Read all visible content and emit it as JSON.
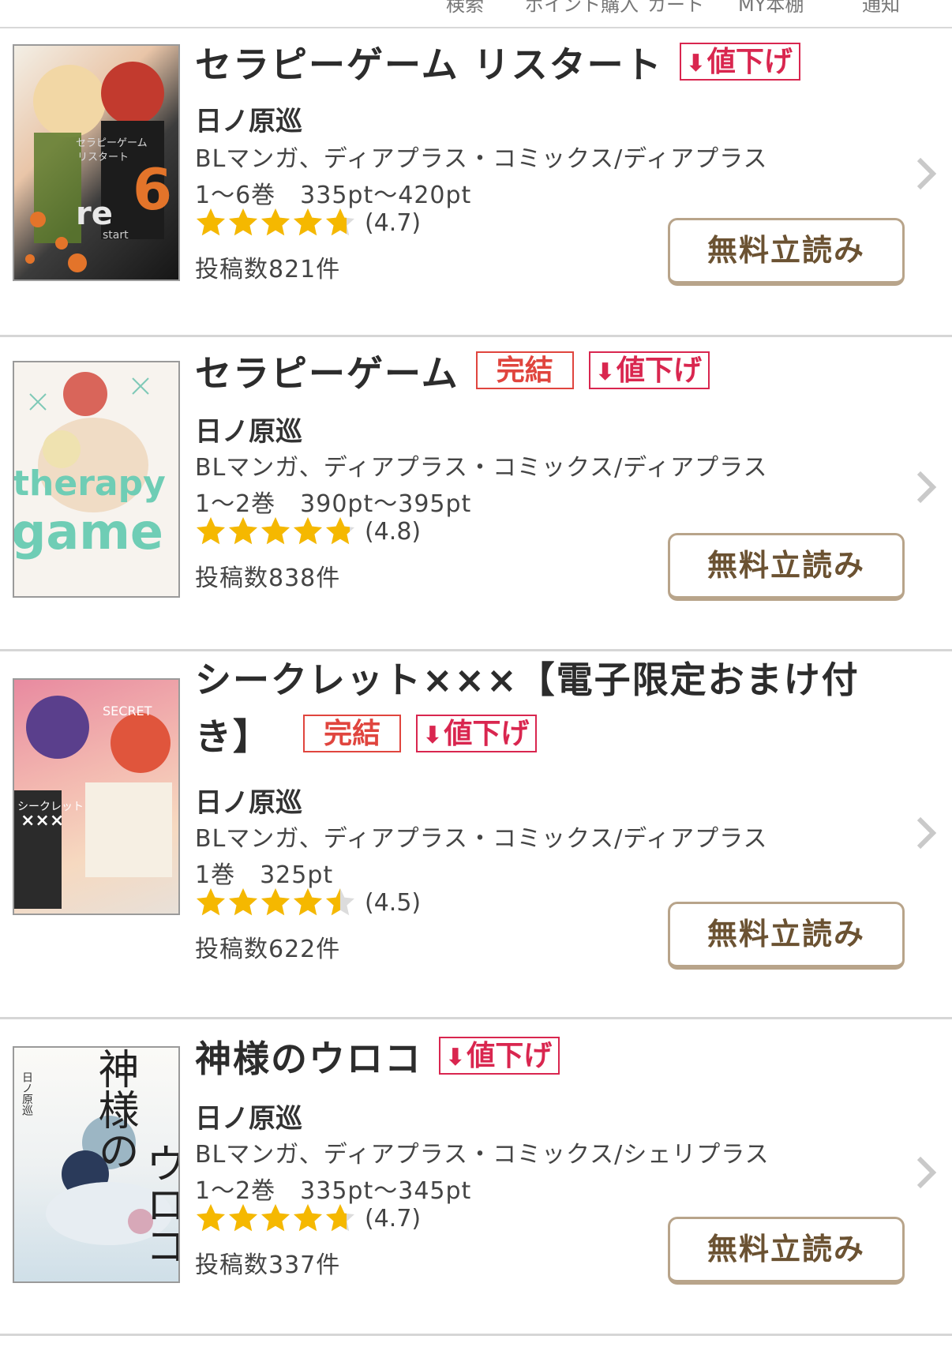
{
  "top_nav": {
    "items": [
      "検索",
      "ポイント購入",
      "カート",
      "MY本棚",
      "通知"
    ]
  },
  "items": [
    {
      "title": "セラピーゲーム リスタート",
      "badges": [
        {
          "type": "down",
          "label": "値下げ",
          "icon": "down-arrow-icon"
        }
      ],
      "author": "日ノ原巡",
      "genre": "BLマンガ、ディアプラス・コミックス/ディアプラス",
      "volumes": "1〜6巻　335pt〜420pt",
      "rating": 4.7,
      "rating_label": "(4.7)",
      "posts": "投稿数821件",
      "button_label": "無料立読み",
      "cover_texts": [
        "セラピーゲーム",
        "リスタート",
        "re",
        "start",
        "6"
      ]
    },
    {
      "title": "セラピーゲーム",
      "badges": [
        {
          "type": "complete",
          "label": "完結"
        },
        {
          "type": "down",
          "label": "値下げ",
          "icon": "down-arrow-icon"
        }
      ],
      "author": "日ノ原巡",
      "genre": "BLマンガ、ディアプラス・コミックス/ディアプラス",
      "volumes": "1〜2巻　390pt〜395pt",
      "rating": 4.8,
      "rating_label": "(4.8)",
      "posts": "投稿数838件",
      "button_label": "無料立読み",
      "cover_texts": [
        "therapy",
        "game"
      ]
    },
    {
      "title": "シークレット×××【電子限定おまけ付き】",
      "badges": [
        {
          "type": "complete",
          "label": "完結"
        },
        {
          "type": "down",
          "label": "値下げ",
          "icon": "down-arrow-icon"
        }
      ],
      "author": "日ノ原巡",
      "genre": "BLマンガ、ディアプラス・コミックス/ディアプラス",
      "volumes": "1巻　325pt",
      "rating": 4.5,
      "rating_label": "(4.5)",
      "posts": "投稿数622件",
      "button_label": "無料立読み",
      "cover_texts": [
        "SECRET",
        "シークレット",
        "×××"
      ]
    },
    {
      "title": "神様のウロコ",
      "badges": [
        {
          "type": "down",
          "label": "値下げ",
          "icon": "down-arrow-icon"
        }
      ],
      "author": "日ノ原巡",
      "genre": "BLマンガ、ディアプラス・コミックス/シェリプラス",
      "volumes": "1〜2巻　335pt〜345pt",
      "rating": 4.7,
      "rating_label": "(4.7)",
      "posts": "投稿数337件",
      "button_label": "無料立読み",
      "cover_texts": [
        "神様の",
        "ウロコ",
        "日ノ原巡"
      ]
    }
  ],
  "colors": {
    "badge_down": "#d9264f",
    "badge_complete": "#e0453e",
    "star": "#f5b800",
    "button_border": "#b8a48a",
    "button_text": "#6b5232"
  }
}
